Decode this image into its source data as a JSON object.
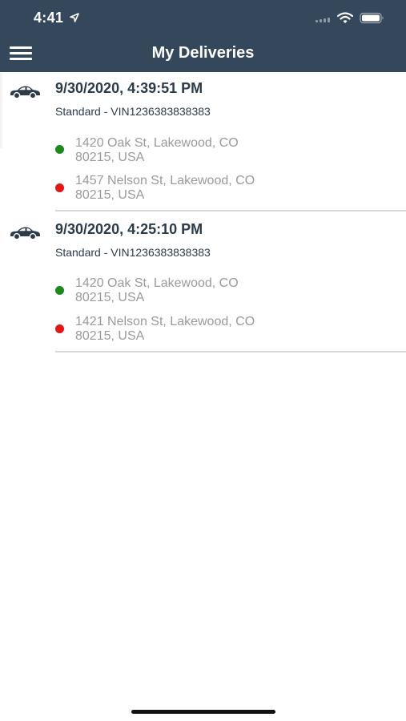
{
  "status_bar": {
    "time": "4:41"
  },
  "header": {
    "title": "My Deliveries"
  },
  "deliveries": [
    {
      "datetime": "9/30/2020, 4:39:51 PM",
      "subtitle": "Standard - VIN1236383838383",
      "pickup": {
        "line1": "1420 Oak St, Lakewood, CO",
        "line2": "80215, USA"
      },
      "dropoff": {
        "line1": "1457 Nelson St, Lakewood, CO",
        "line2": "80215, USA"
      }
    },
    {
      "datetime": "9/30/2020, 4:25:10 PM",
      "subtitle": "Standard - VIN1236383838383",
      "pickup": {
        "line1": "1420 Oak St, Lakewood, CO",
        "line2": "80215, USA"
      },
      "dropoff": {
        "line1": "1421 Nelson St, Lakewood, CO",
        "line2": "80215, USA"
      }
    }
  ],
  "colors": {
    "header_bg": "#34475b",
    "pickup_dot": "#1a8a1a",
    "dropoff_dot": "#e81414",
    "primary_text": "#2c3a4a",
    "address_text": "#9a9a9a"
  },
  "icons": {
    "menu": "hamburger-icon",
    "car": "car-icon",
    "wifi": "wifi-icon",
    "battery": "battery-icon",
    "location": "location-arrow-icon"
  }
}
